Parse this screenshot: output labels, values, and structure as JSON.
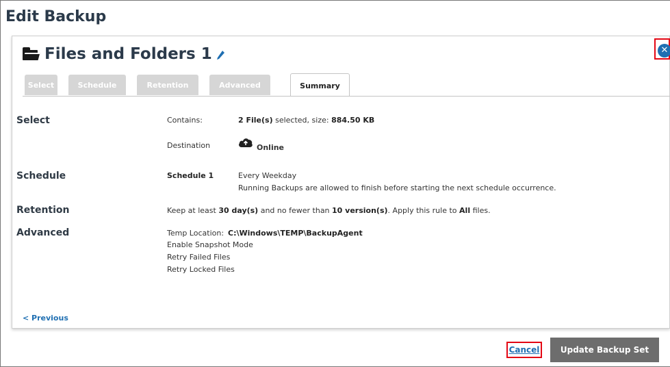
{
  "dialog": {
    "title": "Edit Backup"
  },
  "header": {
    "set_name": "Files and Folders 1"
  },
  "tabs": [
    {
      "label": "Select",
      "active": false
    },
    {
      "label": "Schedule",
      "active": false
    },
    {
      "label": "Retention",
      "active": false
    },
    {
      "label": "Advanced",
      "active": false
    },
    {
      "label": "Summary",
      "active": true
    }
  ],
  "summary": {
    "select": {
      "heading": "Select",
      "contains_label": "Contains:",
      "contains_count": "2 File(s)",
      "contains_mid": "selected, size:",
      "contains_size": "884.50 KB",
      "destination_label": "Destination",
      "destination_value": "Online"
    },
    "schedule": {
      "heading": "Schedule",
      "name": "Schedule 1",
      "frequency": "Every Weekday",
      "note": "Running Backups are allowed to finish before starting the next schedule occurrence."
    },
    "retention": {
      "heading": "Retention",
      "t1": "Keep at least",
      "days": "30 day(s)",
      "t2": "and no fewer than",
      "versions": "10 version(s)",
      "t3": ". Apply this rule to",
      "scope": "All",
      "t4": "files."
    },
    "advanced": {
      "heading": "Advanced",
      "temp_label": "Temp Location:",
      "temp_value": "C:\\Windows\\TEMP\\BackupAgent",
      "options": [
        "Enable Snapshot Mode",
        "Retry Failed Files",
        "Retry Locked Files"
      ]
    }
  },
  "footer": {
    "previous": "< Previous",
    "cancel": "Cancel",
    "update": "Update Backup Set"
  },
  "icons": {
    "folder": "folder-icon",
    "edit": "pencil-icon",
    "close": "close-icon",
    "cloud": "cloud-icon"
  },
  "colors": {
    "accent": "#1f6fb2",
    "highlight_box": "#e30613",
    "primary_button": "#6d6d6d",
    "inactive_tab": "#d6d6d6"
  }
}
